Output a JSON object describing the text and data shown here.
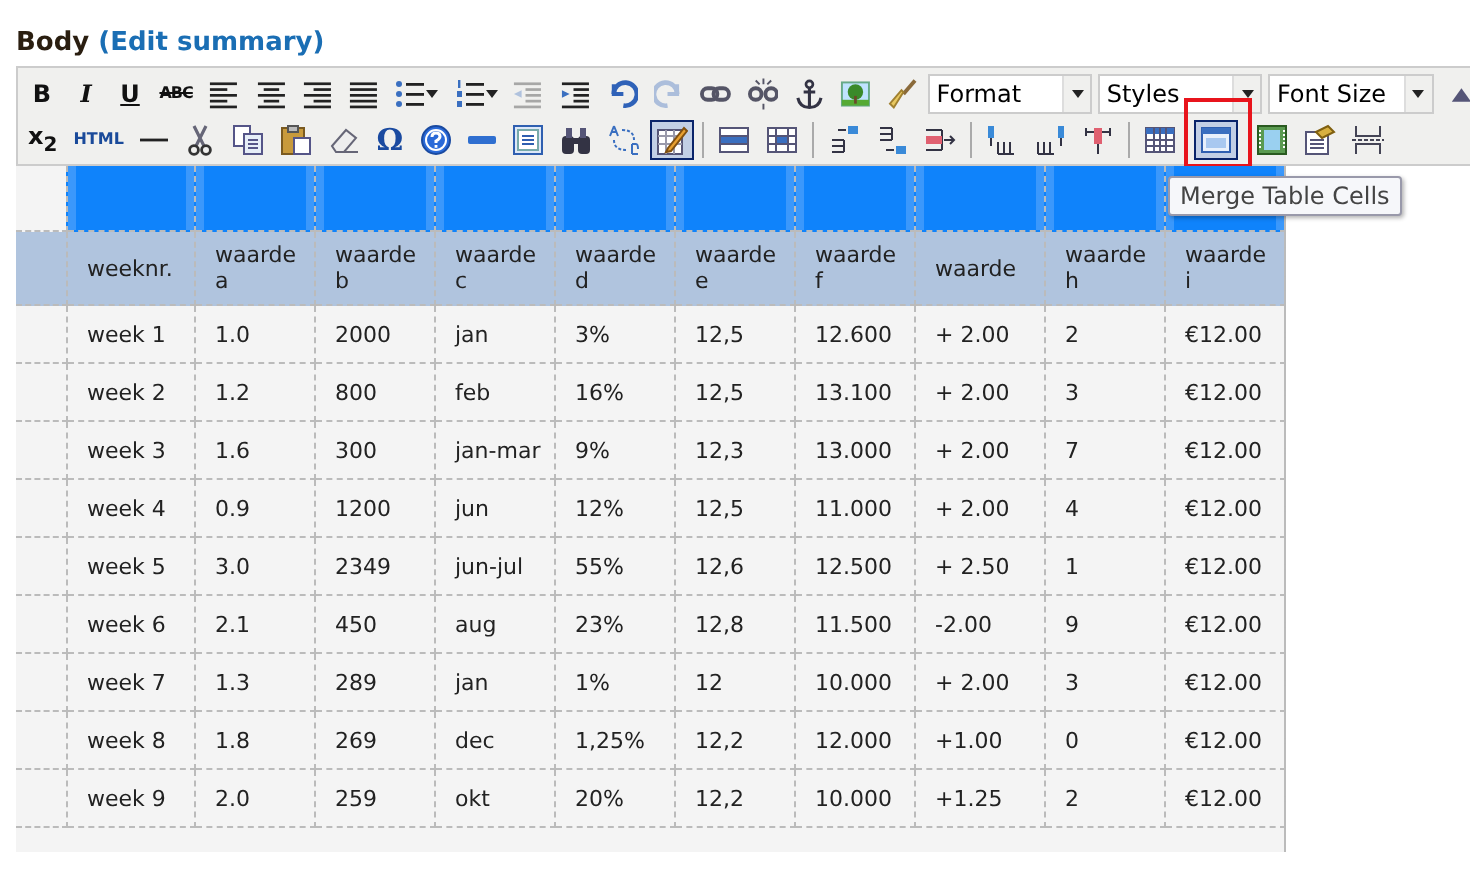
{
  "heading": {
    "label": "Body",
    "link": "(Edit summary)"
  },
  "toolbar": {
    "rows": [
      [
        {
          "kind": "bold",
          "label": "B"
        },
        {
          "kind": "italic",
          "label": "I"
        },
        {
          "kind": "underline",
          "label": "U"
        },
        {
          "kind": "strike",
          "label": "ABC"
        },
        {
          "kind": "align-left"
        },
        {
          "kind": "align-center"
        },
        {
          "kind": "align-right"
        },
        {
          "kind": "justify"
        },
        {
          "kind": "bullet-list"
        },
        {
          "kind": "numbered-list"
        },
        {
          "kind": "outdent",
          "disabled": true
        },
        {
          "kind": "indent"
        },
        {
          "kind": "undo"
        },
        {
          "kind": "redo",
          "disabled": true
        },
        {
          "kind": "link"
        },
        {
          "kind": "unlink"
        },
        {
          "kind": "anchor"
        },
        {
          "kind": "image"
        },
        {
          "kind": "brush"
        },
        {
          "kind": "select",
          "label": "Format"
        },
        {
          "kind": "select",
          "label": "Styles"
        },
        {
          "kind": "select",
          "label": "Font Size"
        },
        {
          "kind": "partial"
        }
      ],
      [
        {
          "kind": "subscript",
          "label": "x$_{2}$"
        },
        {
          "kind": "html",
          "label": "HTML"
        },
        {
          "kind": "rule"
        },
        {
          "kind": "scissors"
        },
        {
          "kind": "copy"
        },
        {
          "kind": "paste"
        },
        {
          "kind": "eraser"
        },
        {
          "kind": "symbol",
          "label": "Ω"
        },
        {
          "kind": "help"
        },
        {
          "kind": "bar"
        },
        {
          "kind": "frame"
        },
        {
          "kind": "binoculars"
        },
        {
          "kind": "replace"
        },
        {
          "kind": "edit",
          "pressed": true
        },
        {
          "kind": "separator"
        },
        {
          "kind": "table-row"
        },
        {
          "kind": "table-cell"
        },
        {
          "kind": "separator"
        },
        {
          "kind": "row-before"
        },
        {
          "kind": "row-after"
        },
        {
          "kind": "row-delete"
        },
        {
          "kind": "separator"
        },
        {
          "kind": "col-before"
        },
        {
          "kind": "col-after"
        },
        {
          "kind": "col-delete"
        },
        {
          "kind": "separator"
        },
        {
          "kind": "table"
        },
        {
          "kind": "merge",
          "pressed": true,
          "highlighted": true
        },
        {
          "kind": "split"
        },
        {
          "kind": "properties"
        },
        {
          "kind": "page-break"
        }
      ]
    ]
  },
  "tooltip": "Merge Table Cells",
  "table": {
    "selection_row": {
      "selected": true
    },
    "columns": [
      "weeknr.",
      "waarde a",
      "waarde b",
      "waarde c",
      "waarde d",
      "waarde e",
      "waarde f",
      "waarde",
      "waarde h",
      "waarde i"
    ],
    "rows": [
      [
        "week 1",
        "1.0",
        "2000",
        "jan",
        "3%",
        "12,5",
        "12.600",
        "+ 2.00",
        "2",
        "€12.00"
      ],
      [
        "week 2",
        "1.2",
        "800",
        "feb",
        "16%",
        "12,5",
        "13.100",
        "+ 2.00",
        "3",
        "€12.00"
      ],
      [
        "week 3",
        "1.6",
        "300",
        "jan-mar",
        "9%",
        "12,3",
        "13.000",
        "+ 2.00",
        "7",
        "€12.00"
      ],
      [
        "week 4",
        "0.9",
        "1200",
        "jun",
        "12%",
        "12,5",
        "11.000",
        "+ 2.00",
        "4",
        "€12.00"
      ],
      [
        "week 5",
        "3.0",
        "2349",
        "jun-jul",
        "55%",
        "12,6",
        "12.500",
        "+ 2.50",
        "1",
        "€12.00"
      ],
      [
        "week 6",
        "2.1",
        "450",
        "aug",
        "23%",
        "12,8",
        "11.500",
        "-2.00",
        "9",
        "€12.00"
      ],
      [
        "week 7",
        "1.3",
        "289",
        "jan",
        "1%",
        "12",
        "10.000",
        "+ 2.00",
        "3",
        "€12.00"
      ],
      [
        "week 8",
        "1.8",
        "269",
        "dec",
        "1,25%",
        "12,2",
        "12.000",
        "+1.00",
        "0",
        "€12.00"
      ],
      [
        "week 9",
        "2.0",
        "259",
        "okt",
        "20%",
        "12,2",
        "10.000",
        "+1.25",
        "2",
        "€12.00"
      ]
    ]
  }
}
